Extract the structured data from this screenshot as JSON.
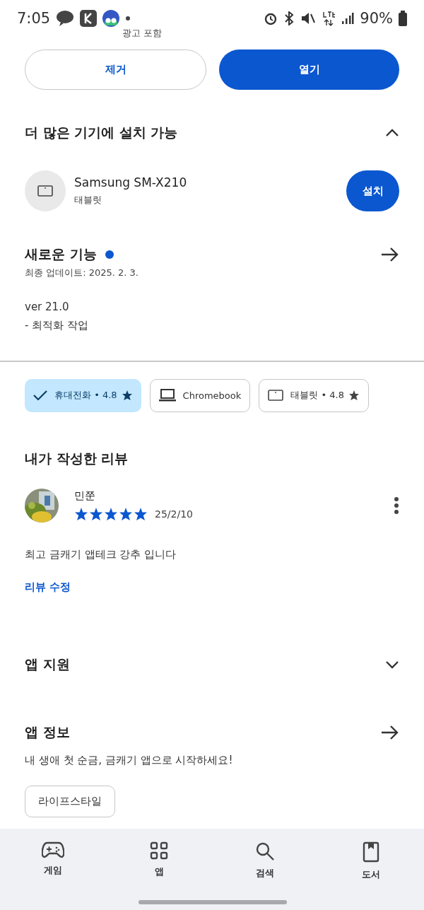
{
  "status_bar": {
    "time": "7:05",
    "battery": "90%"
  },
  "ad_label": "광고 포함",
  "actions": [
    {
      "label": "제거",
      "kind": "outline"
    },
    {
      "label": "열기",
      "kind": "filled"
    }
  ],
  "more_devices": {
    "title": "더 많은 기기에 설치 가능",
    "expanded": true,
    "device": {
      "name": "Samsung SM-X210",
      "type": "태블릿",
      "button": "설치"
    }
  },
  "whats_new": {
    "title": "새로운 기능",
    "date": "최종 업데이트: 2025. 2. 3.",
    "version": "ver 21.0",
    "notes": "- 최적화 작업"
  },
  "device_filters": [
    {
      "label": "휴대전화 • 4.8",
      "kind": "phone",
      "star": true,
      "selected": true
    },
    {
      "label": "Chromebook",
      "kind": "laptop",
      "star": false,
      "selected": false
    },
    {
      "label": "태블릿 • 4.8",
      "kind": "tablet",
      "star": true,
      "selected": false
    }
  ],
  "my_review": {
    "title": "내가 작성한 리뷰",
    "reviewer": "민쭌",
    "stars": 5,
    "date": "25/2/10",
    "text": "최고 금캐기 앱테크 강추 입니다",
    "edit_link": "리뷰 수정"
  },
  "app_support": {
    "title": "앱 지원",
    "expanded": false
  },
  "app_info": {
    "title": "앱 정보",
    "description": "내 생애 첫 순금, 금캐기 앱으로 시작하세요!",
    "tags": [
      "라이프스타일"
    ]
  },
  "nav": [
    {
      "label": "게임",
      "kind": "games"
    },
    {
      "label": "앱",
      "kind": "apps"
    },
    {
      "label": "검색",
      "kind": "search"
    },
    {
      "label": "도서",
      "kind": "books"
    }
  ]
}
